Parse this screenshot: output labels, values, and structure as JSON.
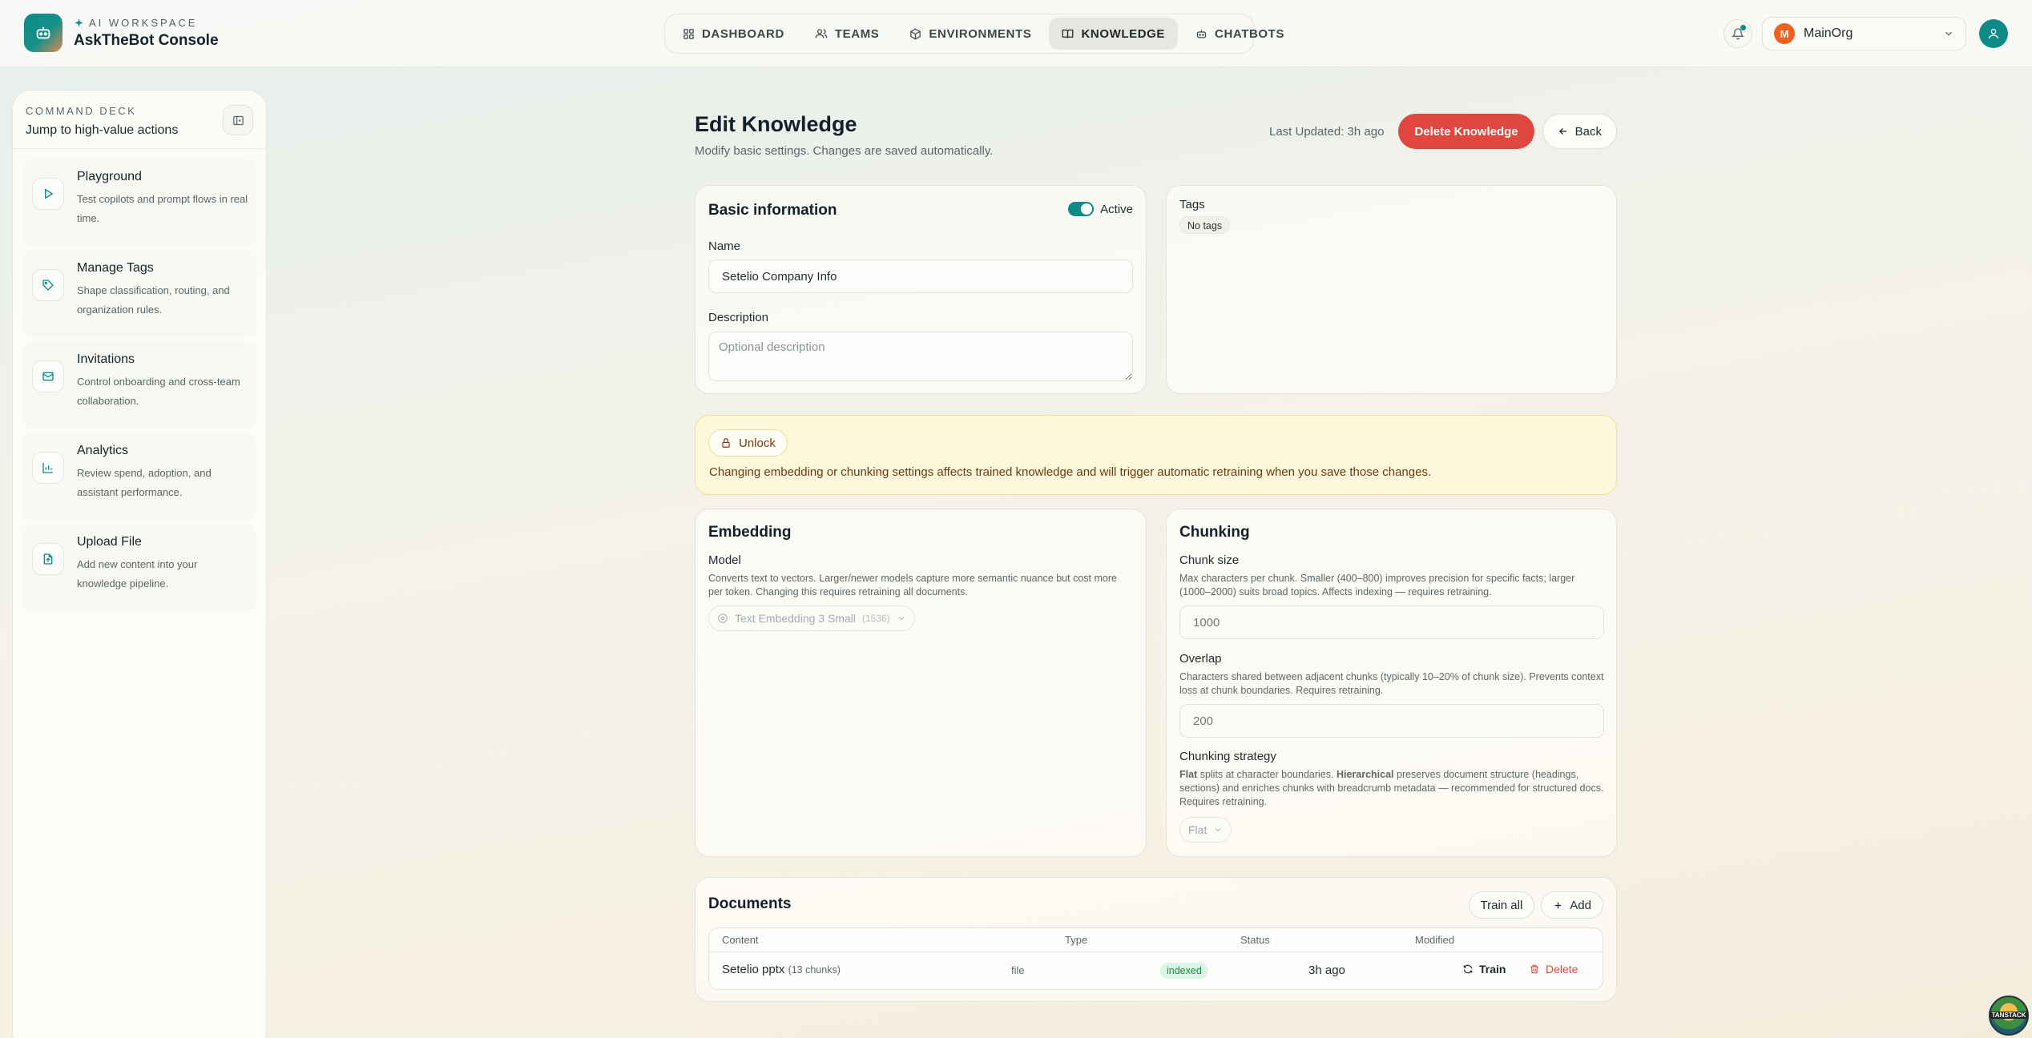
{
  "brand": {
    "kicker": "AI WORKSPACE",
    "title": "AskTheBot Console"
  },
  "nav": {
    "items": [
      {
        "label": "DASHBOARD",
        "icon": "grid-icon"
      },
      {
        "label": "TEAMS",
        "icon": "users-icon"
      },
      {
        "label": "ENVIRONMENTS",
        "icon": "cube-icon"
      },
      {
        "label": "KNOWLEDGE",
        "icon": "book-icon",
        "active": true
      },
      {
        "label": "CHATBOTS",
        "icon": "bot-icon"
      }
    ]
  },
  "org": {
    "initial": "M",
    "name": "MainOrg"
  },
  "sidebar": {
    "kicker": "COMMAND DECK",
    "subtitle": "Jump to high-value actions",
    "items": [
      {
        "title": "Playground",
        "desc": "Test copilots and prompt flows in real time.",
        "icon": "play-icon"
      },
      {
        "title": "Manage Tags",
        "desc": "Shape classification, routing, and organization rules.",
        "icon": "tag-icon"
      },
      {
        "title": "Invitations",
        "desc": "Control onboarding and cross-team collaboration.",
        "icon": "mail-icon"
      },
      {
        "title": "Analytics",
        "desc": "Review spend, adoption, and assistant performance.",
        "icon": "bar-chart-icon"
      },
      {
        "title": "Upload File",
        "desc": "Add new content into your knowledge pipeline.",
        "icon": "file-upload-icon"
      }
    ]
  },
  "page": {
    "title": "Edit Knowledge",
    "subtitle": "Modify basic settings. Changes are saved automatically.",
    "last_updated": "Last Updated: 3h ago",
    "delete_label": "Delete Knowledge",
    "back_label": "Back"
  },
  "basic": {
    "title": "Basic information",
    "active_label": "Active",
    "name_label": "Name",
    "name_value": "Setelio Company Info",
    "description_label": "Description",
    "description_placeholder": "Optional description"
  },
  "tags": {
    "title": "Tags",
    "empty": "No tags"
  },
  "notice": {
    "unlock_label": "Unlock",
    "text": "Changing embedding or chunking settings affects trained knowledge and will trigger automatic retraining when you save those changes."
  },
  "embedding": {
    "title": "Embedding",
    "model_label": "Model",
    "model_help": "Converts text to vectors. Larger/newer models capture more semantic nuance but cost more per token. Changing this requires retraining all documents.",
    "model_value": "Text Embedding 3 Small",
    "model_dims": "(1536)"
  },
  "chunking": {
    "title": "Chunking",
    "size_label": "Chunk size",
    "size_help": "Max characters per chunk. Smaller (400–800) improves precision for specific facts; larger (1000–2000) suits broad topics. Affects indexing — requires retraining.",
    "size_placeholder": "1000",
    "overlap_label": "Overlap",
    "overlap_help": "Characters shared between adjacent chunks (typically 10–20% of chunk size). Prevents context loss at chunk boundaries. Requires retraining.",
    "overlap_placeholder": "200",
    "strategy_label": "Chunking strategy",
    "strategy_help_flat": "Flat",
    "strategy_help_1": " splits at character boundaries. ",
    "strategy_help_hier": "Hierarchical",
    "strategy_help_2": " preserves document structure (headings, sections) and enriches chunks with breadcrumb metadata — recommended for structured docs. Requires retraining.",
    "strategy_value": "Flat"
  },
  "documents": {
    "title": "Documents",
    "train_all_label": "Train all",
    "add_label": "Add",
    "columns": [
      "Content",
      "Type",
      "Status",
      "Modified"
    ],
    "rows": [
      {
        "content": "Setelio pptx",
        "chunks": "(13 chunks)",
        "type": "file",
        "status": "indexed",
        "modified": "3h ago",
        "train_label": "Train",
        "delete_label": "Delete"
      }
    ]
  },
  "colors": {
    "accent": "#0e8b86",
    "danger": "#e0473f",
    "notice_bg": "#fdf8dc",
    "org_avatar": "#f0611f"
  },
  "corner_badge": "TANSTACK"
}
